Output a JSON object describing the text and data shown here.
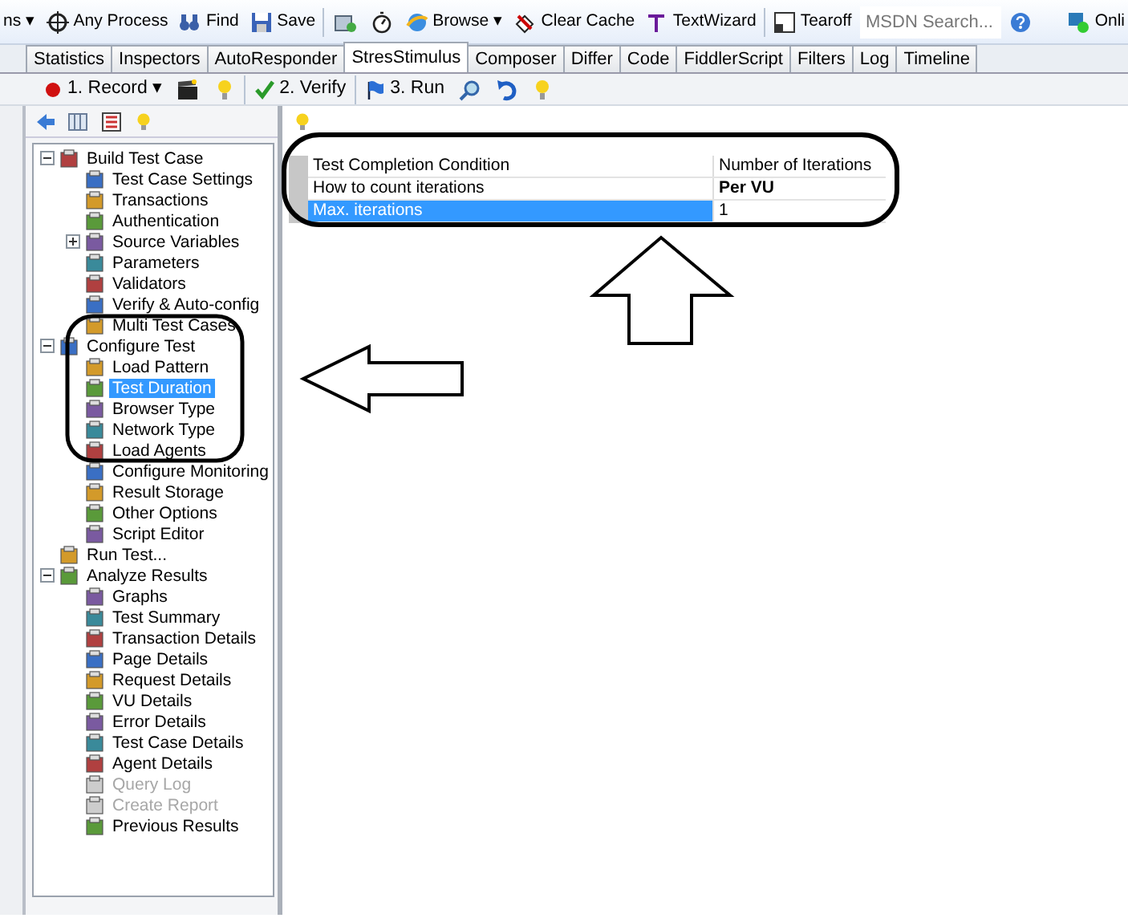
{
  "toolbar": {
    "items": [
      {
        "kind": "text",
        "label": "ns ▾"
      },
      {
        "kind": "button",
        "label": "Any Process"
      },
      {
        "kind": "button",
        "label": "Find"
      },
      {
        "kind": "button",
        "label": "Save"
      },
      {
        "kind": "sep"
      },
      {
        "kind": "icon"
      },
      {
        "kind": "icon"
      },
      {
        "kind": "button",
        "label": "Browse ▾"
      },
      {
        "kind": "button",
        "label": "Clear Cache"
      },
      {
        "kind": "button",
        "label": "TextWizard"
      },
      {
        "kind": "sep"
      },
      {
        "kind": "button",
        "label": "Tearoff"
      },
      {
        "kind": "search",
        "placeholder": "MSDN Search..."
      },
      {
        "kind": "icon"
      },
      {
        "kind": "spacer"
      },
      {
        "kind": "button",
        "label": "Onli"
      }
    ]
  },
  "tabs": [
    {
      "label": "Statistics",
      "selected": false
    },
    {
      "label": "Inspectors",
      "selected": false
    },
    {
      "label": "AutoResponder",
      "selected": false
    },
    {
      "label": "StresStimulus",
      "selected": true
    },
    {
      "label": "Composer",
      "selected": false
    },
    {
      "label": "Differ",
      "selected": false
    },
    {
      "label": "Code",
      "selected": false
    },
    {
      "label": "FiddlerScript",
      "selected": false
    },
    {
      "label": "Filters",
      "selected": false
    },
    {
      "label": "Log",
      "selected": false
    },
    {
      "label": "Timeline",
      "selected": false
    }
  ],
  "subtoolbar": [
    {
      "kind": "record",
      "label": "1. Record ▾"
    },
    {
      "kind": "icon"
    },
    {
      "kind": "icon"
    },
    {
      "kind": "sep"
    },
    {
      "kind": "verify",
      "label": "2. Verify"
    },
    {
      "kind": "sep"
    },
    {
      "kind": "run",
      "label": "3. Run"
    },
    {
      "kind": "icon"
    },
    {
      "kind": "icon"
    },
    {
      "kind": "icon"
    }
  ],
  "tree": [
    {
      "label": "Build Test Case",
      "expanded": true,
      "selected": false,
      "disabled": false,
      "children": [
        {
          "label": "Test Case Settings",
          "selected": false,
          "disabled": false
        },
        {
          "label": "Transactions",
          "selected": false,
          "disabled": false
        },
        {
          "label": "Authentication",
          "selected": false,
          "disabled": false
        },
        {
          "label": "Source Variables",
          "expanded": false,
          "selected": false,
          "disabled": false
        },
        {
          "label": "Parameters",
          "selected": false,
          "disabled": false
        },
        {
          "label": "Validators",
          "selected": false,
          "disabled": false
        },
        {
          "label": "Verify & Auto-config",
          "selected": false,
          "disabled": false
        },
        {
          "label": "Multi Test Cases",
          "selected": false,
          "disabled": false
        }
      ]
    },
    {
      "label": "Configure Test",
      "expanded": true,
      "selected": false,
      "disabled": false,
      "children": [
        {
          "label": "Load Pattern",
          "selected": false,
          "disabled": false
        },
        {
          "label": "Test Duration",
          "selected": true,
          "disabled": false
        },
        {
          "label": "Browser Type",
          "selected": false,
          "disabled": false
        },
        {
          "label": "Network Type",
          "selected": false,
          "disabled": false
        },
        {
          "label": "Load Agents",
          "selected": false,
          "disabled": false
        },
        {
          "label": "Configure Monitoring",
          "selected": false,
          "disabled": false
        },
        {
          "label": "Result Storage",
          "selected": false,
          "disabled": false
        },
        {
          "label": "Other Options",
          "selected": false,
          "disabled": false
        },
        {
          "label": "Script Editor",
          "selected": false,
          "disabled": false
        }
      ]
    },
    {
      "label": "Run Test...",
      "selected": false,
      "disabled": false
    },
    {
      "label": "Analyze Results",
      "expanded": true,
      "selected": false,
      "disabled": false,
      "children": [
        {
          "label": "Graphs",
          "selected": false,
          "disabled": false
        },
        {
          "label": "Test Summary",
          "selected": false,
          "disabled": false
        },
        {
          "label": "Transaction Details",
          "selected": false,
          "disabled": false
        },
        {
          "label": "Page Details",
          "selected": false,
          "disabled": false
        },
        {
          "label": "Request Details",
          "selected": false,
          "disabled": false
        },
        {
          "label": "VU Details",
          "selected": false,
          "disabled": false
        },
        {
          "label": "Error Details",
          "selected": false,
          "disabled": false
        },
        {
          "label": "Test Case Details",
          "selected": false,
          "disabled": false
        },
        {
          "label": "Agent Details",
          "selected": false,
          "disabled": false
        },
        {
          "label": "Query Log",
          "selected": false,
          "disabled": true
        },
        {
          "label": "Create Report",
          "selected": false,
          "disabled": true
        },
        {
          "label": "Previous Results",
          "selected": false,
          "disabled": false
        }
      ]
    }
  ],
  "property_grid": {
    "rows": [
      {
        "name": "Test Completion Condition",
        "value": "Number of Iterations",
        "bold": false,
        "selected": false
      },
      {
        "name": "How to count iterations",
        "value": "Per VU",
        "bold": true,
        "selected": false
      },
      {
        "name": "Max. iterations",
        "value": "1",
        "bold": false,
        "selected": true
      }
    ]
  }
}
